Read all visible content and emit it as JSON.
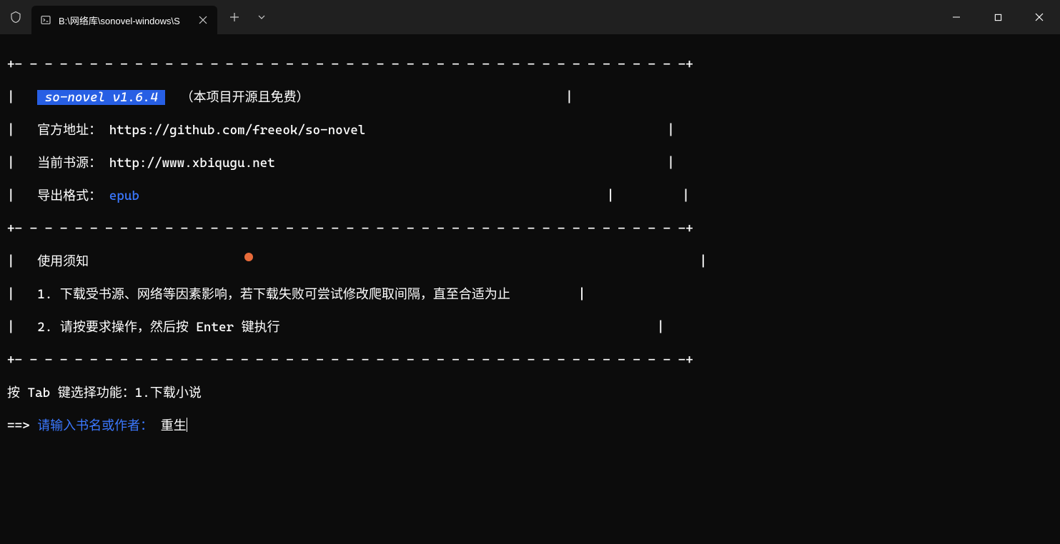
{
  "titlebar": {
    "tab_title": "B:\\网络库\\sonovel-windows\\S"
  },
  "border": {
    "top": "+- - - - - - - - - - - - - - - - - - - - - - - - - - - - - - - - - - - - - - - - - - - - -+",
    "mid": "+- - - - - - - - - - - - - - - - - - - - - - - - - - - - - - - - - - - - - - - - - - - - -+",
    "bottom": "+- - - - - - - - - - - - - - - - - - - - - - - - - - - - - - - - - - - - - - - - - - - - -+"
  },
  "banner": {
    "app_version_pre": " ",
    "app_version": "so-novel v1.6.4",
    "app_version_post": " ",
    "project_note": "（本项目开源且免费）",
    "line1_end_spaces": "                                  |",
    "official_label": "官方地址：",
    "official_url": " https://github.com/freeok/so-novel",
    "official_end": "                                        |",
    "source_label": "当前书源：",
    "source_url": " http://www.xbiqugu.net",
    "source_end": "                                                    |",
    "format_label": "导出格式：",
    "format_value": " epub",
    "format_sep": "                                                              |         |"
  },
  "usage": {
    "title": "使用须知",
    "title_end": "                                                                                 |",
    "line1": "1. 下载受书源、网络等因素影响，若下载失败可尝试修改爬取间隔，直至合适为止",
    "line1_end": "         |",
    "line2": "2. 请按要求操作，然后按 Enter 键执行",
    "line2_end": "                                                  |"
  },
  "prompt": {
    "tab_line": "按 Tab 键选择功能：1.下载小说",
    "arrow": "==> ",
    "input_label": "请输入书名或作者：",
    "input_value": " 重生"
  }
}
